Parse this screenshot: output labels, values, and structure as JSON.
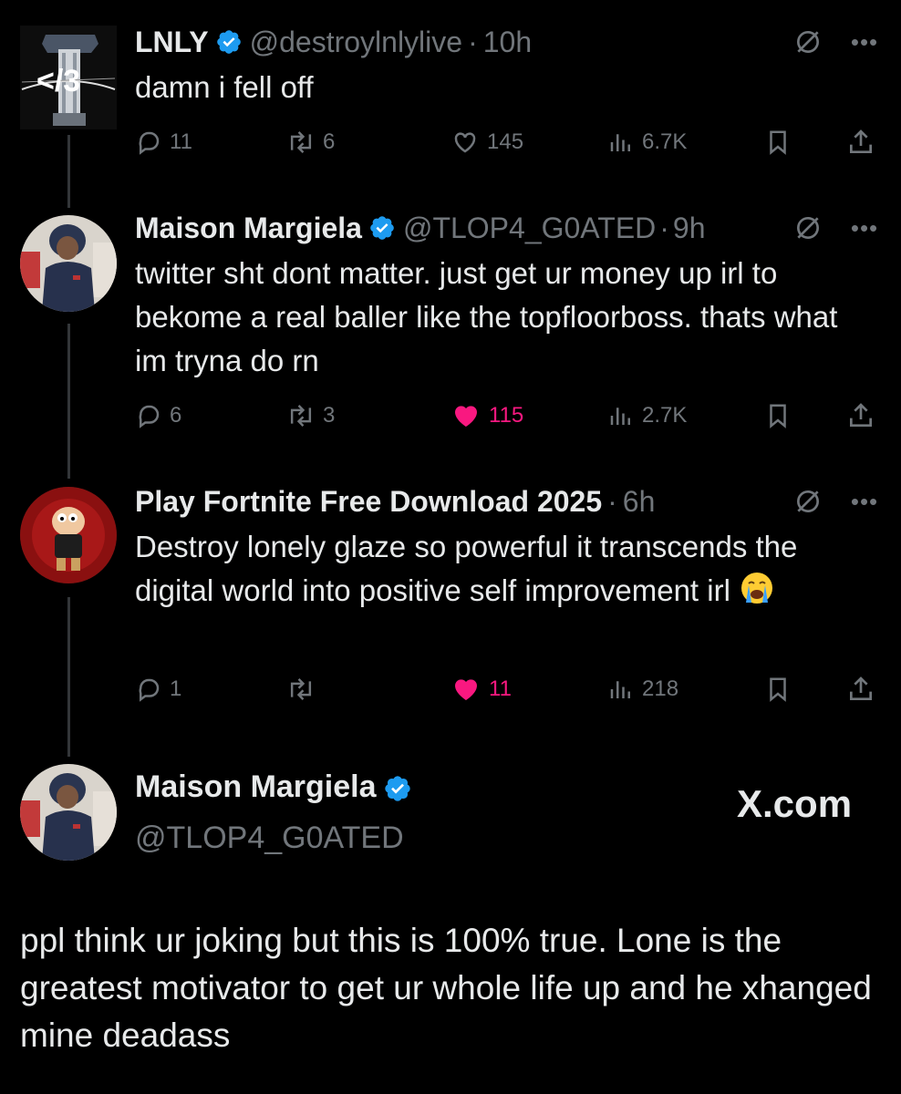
{
  "colors": {
    "background": "#000000",
    "text": "#e7e9ea",
    "muted": "#71767b",
    "verified": "#1d9bf0",
    "like": "#f91880"
  },
  "tweets": [
    {
      "name": "LNLY",
      "handle": "@destroylnlylive",
      "dot": "·",
      "time": "10h",
      "avatar_text": "</3",
      "text": "damn i fell off",
      "replies": "11",
      "reposts": "6",
      "likes": "145",
      "liked": false,
      "views": "6.7K"
    },
    {
      "name": "Maison Margiela",
      "handle": "@TLOP4_G0ATED",
      "dot": "·",
      "time": "9h",
      "text": "twitter sht dont matter. just get ur money up irl to bekome a real baller like the topfloorboss. thats what im tryna do rn",
      "replies": "6",
      "reposts": "3",
      "likes": "115",
      "liked": true,
      "views": "2.7K"
    },
    {
      "name": "Play Fortnite Free Download 2025",
      "dot": "·",
      "time": "6h",
      "text": "Destroy lonely glaze so powerful it transcends the digital world into positive self improvement irl",
      "emoji": "loudly-crying-face",
      "replies": "1",
      "reposts": "",
      "likes": "11",
      "liked": true,
      "views": "218"
    }
  ],
  "quote": {
    "name": "Maison Margiela",
    "handle": "@TLOP4_G0ATED",
    "site": "X.com",
    "text": "ppl think ur joking but this is 100% true. Lone is the greatest motivator to get ur whole life up and he xhanged mine deadass"
  },
  "icons": [
    "reply-icon",
    "repost-icon",
    "like-icon",
    "views-icon",
    "bookmark-icon",
    "share-icon",
    "grok-icon",
    "more-icon",
    "verified-icon"
  ]
}
